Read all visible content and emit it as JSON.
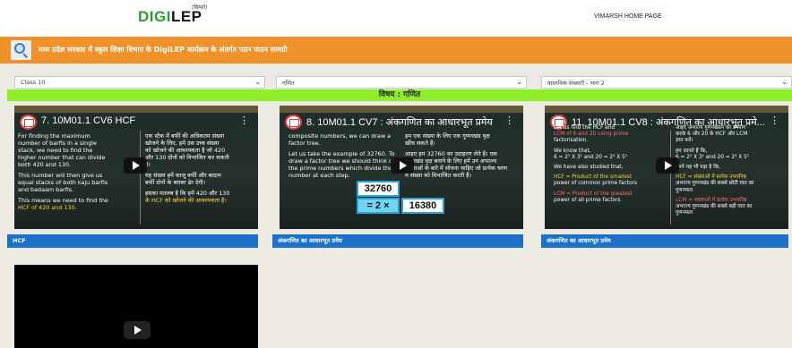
{
  "header": {
    "logo_text_a": "DIGI",
    "logo_text_b": "LEP",
    "logo_sup": "(विमर्श)",
    "home_link": "VIMARSH HOME PAGE"
  },
  "banner": {
    "text": "मध्य प्रदेश सरकार में स्कूल शिक्षा विभाग के DigiLEP कार्यक्रम के अंतर्गत पठन पाठन सामग्री"
  },
  "filters": {
    "class": "Class 10",
    "subject": "गणित",
    "chapter": "वास्तविक संख्याएँ - भाग 2"
  },
  "subject_heading": "विषय : गणित",
  "videos": [
    {
      "title": "7. 10M01.1 CV6 HCF",
      "caption": "HCF",
      "left_col": [
        "For finding the maximum",
        "number of barfis in a single",
        "stack, we need to find the",
        "higher number that can divide",
        "both 420 and 130.",
        "",
        "This number will then give us",
        "equal stacks of both kaju barfis",
        "and badaam barfis.",
        "",
        "This means we need to find the",
        "HCF of 420 and 130."
      ],
      "right_col": [
        "एक स्टैक में बर्फी की अधिकतम संख्या",
        "खोजने के लिए, हमें उस उच्च संख्या",
        "को खोजने की आवश्यकता है जो 420",
        "और 130 दोनों को विभाजित कर सकती",
        "है।",
        "",
        "यह संख्या हमें काजू बर्फी और बादाम",
        "बर्फी दोनों के बराबर ढेर देगी।",
        "",
        "इसका मतलब है कि हमें 420 और 130",
        "के HCF को खोजने की आवश्यकता है।"
      ]
    },
    {
      "title": "8. 10M01.1 CV7 : अंकगणित का आधारभूत प्रमेय",
      "caption": "अंकगणित का आधारभूत प्रमेय",
      "left_col": [
        "composite numbers, we can draw a",
        "factor tree.",
        "",
        "Let us take the example of 32760. To",
        "draw a factor tree we should think of",
        "the prime numbers which divide the",
        "number at each step."
      ],
      "right_col": [
        "हम एक संख्या के लिए एक गुणनखंड वृक्ष",
        "खींच सकते हैं।",
        "",
        "आइए हम 32760 का उदाहरण लेते हैं। एक",
        "गुणनखंड वृक्ष बनाने के लिए हमें उन अभाज्य",
        "संख्याओं के बारे में सोचना चाहिए जो प्रत्येक चरण",
        "में संख्या को विभाजित करती हैं।"
      ],
      "number": "32760",
      "eq_left": "= 2 ×",
      "eq_right": "16380"
    },
    {
      "title": "11. 10M01.1 CV8 : अंकगणित का आधारभूत प्रमे...",
      "caption": "अंकगणित का आधारभूत प्रमेय",
      "left_col": [
        "Let us find the HCF and",
        "LCM of 6 and 20 using prime",
        "factorisation.",
        "",
        "We know that,",
        "6 = 2¹ X 3¹ and 20 = 2² X 5¹",
        "",
        "We have also studied that,",
        "",
        "HCF = Product of the smallest",
        "power of common prime factors",
        "",
        "LCM = Product of the greatest",
        "power of all prime factors"
      ],
      "right_col": [
        "आइए अभाज्य गुणनखंडन का उपयोग",
        "करके 6 और 20 के HCF और LCM",
        "ज्ञात करें।",
        "",
        "हम जानते हैं कि,",
        "6 = 2¹ X 3¹ and 20 = 2² X 5¹",
        "",
        "हमने यह भी पढ़ा है कि,",
        "",
        "HCF = संख्याओं में प्रत्येक उभयनिष्ठ",
        "अभाज्य गुणनखंड की सबसे छोटी घात का",
        "गुणनफल",
        "",
        "LCM = संख्याओं में प्रत्येक उभयनिष्ठ",
        "अभाज्य गुणनखंड की सबसे बड़ी घात का",
        "गुणनफल"
      ]
    }
  ]
}
